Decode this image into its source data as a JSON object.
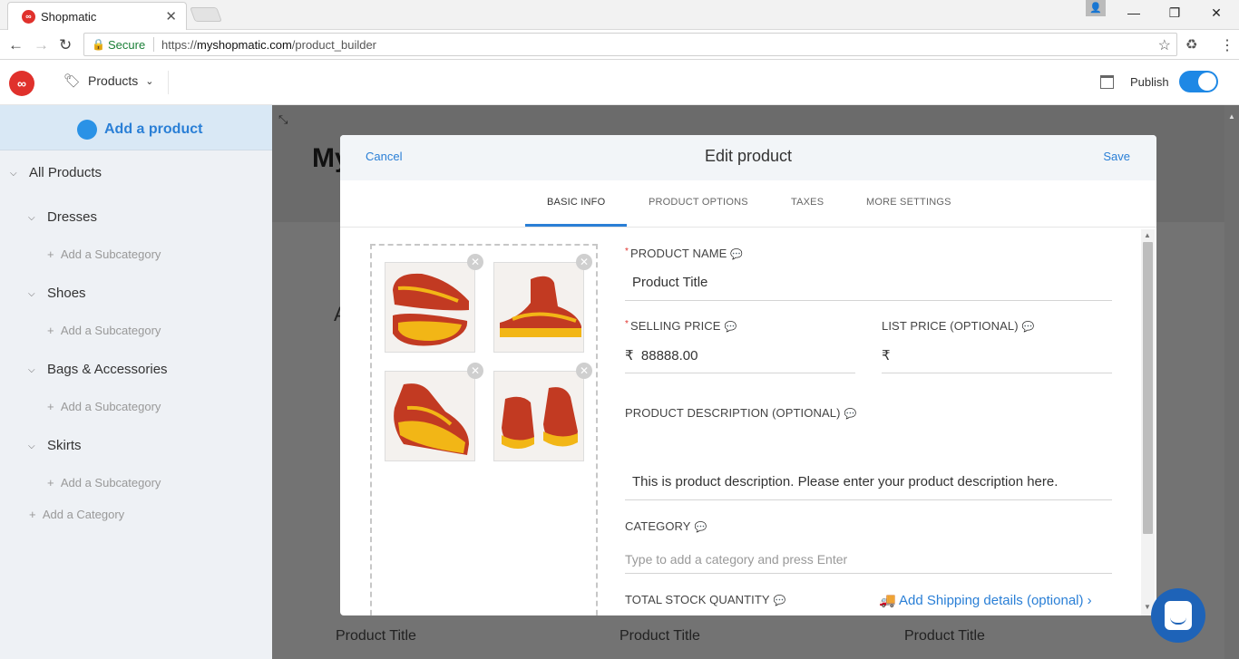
{
  "browser": {
    "tab_title": "Shopmatic",
    "secure_label": "Secure",
    "url_scheme": "https://",
    "url_host": "myshopmatic.com",
    "url_path": "/product_builder"
  },
  "header": {
    "products_menu": "Products",
    "publish_label": "Publish",
    "publish_on": true
  },
  "sidebar": {
    "add_product": "Add a product",
    "all_products": "All Products",
    "categories": [
      {
        "name": "Dresses",
        "sub": "Add a Subcategory"
      },
      {
        "name": "Shoes",
        "sub": "Add a Subcategory"
      },
      {
        "name": "Bags & Accessories",
        "sub": "Add a Subcategory"
      },
      {
        "name": "Skirts",
        "sub": "Add a Subcategory"
      }
    ],
    "add_category": "Add a Category"
  },
  "background": {
    "title_partial": "My",
    "letter_partial": "A",
    "product_titles": [
      "Product Title",
      "Product Title",
      "Product Title"
    ]
  },
  "modal": {
    "cancel": "Cancel",
    "title": "Edit product",
    "save": "Save",
    "tabs": [
      "BASIC INFO",
      "PRODUCT OPTIONS",
      "TAXES",
      "MORE SETTINGS"
    ],
    "active_tab": "BASIC INFO",
    "fields": {
      "product_name_label": "PRODUCT NAME",
      "product_name_value": "Product Title",
      "selling_price_label": "SELLING PRICE",
      "currency": "₹",
      "selling_price_value": "88888.00",
      "list_price_label": "LIST PRICE (OPTIONAL)",
      "list_price_value": "",
      "description_label": "PRODUCT DESCRIPTION (OPTIONAL)",
      "description_value": "This is product description. Please enter your product description here.",
      "category_label": "CATEGORY",
      "category_placeholder": "Type to add a category and press Enter",
      "stock_label": "TOTAL STOCK QUANTITY",
      "shipping_link": "Add Shipping details (optional)"
    }
  },
  "colors": {
    "accent": "#2a7fd6",
    "brand_red": "#e0312c",
    "shoe_red": "#c23a22",
    "shoe_yellow": "#f2b616"
  }
}
